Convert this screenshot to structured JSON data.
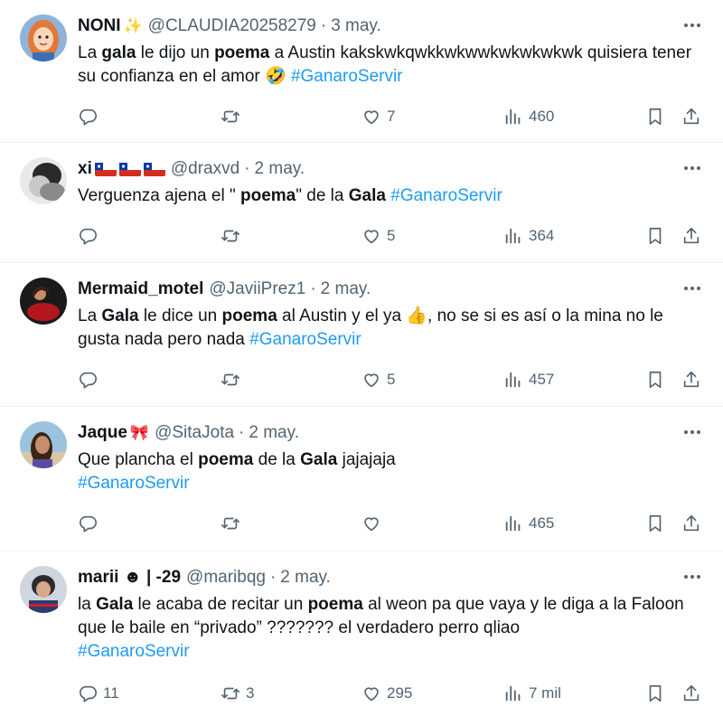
{
  "tweets": [
    {
      "name": "NONI",
      "name_emoji": "✨",
      "handle": "@CLAUDIA20258279",
      "date": "3 may.",
      "body": [
        {
          "t": "La "
        },
        {
          "t": "gala",
          "b": true
        },
        {
          "t": " le dijo un "
        },
        {
          "t": "poema",
          "b": true
        },
        {
          "t": " a Austin kakskwkqwkkwkwwkwkwkwkwk quisiera tener su confianza en el amor 🤣 "
        },
        {
          "t": "#GanaroServir",
          "h": true
        }
      ],
      "replies": "",
      "retweets": "",
      "likes": "7",
      "views": "460"
    },
    {
      "name": "xi",
      "flags": 3,
      "handle": "@draxvd",
      "date": "2 may.",
      "body": [
        {
          "t": "Verguenza ajena el \" "
        },
        {
          "t": "poema",
          "b": true
        },
        {
          "t": "\" de la "
        },
        {
          "t": "Gala",
          "b": true
        },
        {
          "t": " "
        },
        {
          "t": "#GanaroServir",
          "h": true
        }
      ],
      "replies": "",
      "retweets": "",
      "likes": "5",
      "views": "364"
    },
    {
      "name": "Mermaid_motel",
      "handle": "@JaviiPrez1",
      "date": "2 may.",
      "body": [
        {
          "t": "La "
        },
        {
          "t": "Gala",
          "b": true
        },
        {
          "t": " le dice un "
        },
        {
          "t": "poema",
          "b": true
        },
        {
          "t": " al Austin y el ya 👍, no se si es así o la mina no le gusta nada pero nada "
        },
        {
          "t": "#GanaroServir",
          "h": true
        }
      ],
      "replies": "",
      "retweets": "",
      "likes": "5",
      "views": "457"
    },
    {
      "name": "Jaque",
      "name_emoji": "🎀",
      "handle": "@SitaJota",
      "date": "2 may.",
      "body": [
        {
          "t": "Que plancha el "
        },
        {
          "t": "poema",
          "b": true
        },
        {
          "t": " de la "
        },
        {
          "t": "Gala",
          "b": true
        },
        {
          "t": " jajajaja"
        },
        {
          "br": true
        },
        {
          "t": "#GanaroServir",
          "h": true
        }
      ],
      "replies": "",
      "retweets": "",
      "likes": "",
      "views": "465"
    },
    {
      "name": "marii ☻ | -29",
      "handle": "@maribqg",
      "date": "2 may.",
      "body": [
        {
          "t": "la "
        },
        {
          "t": "Gala",
          "b": true
        },
        {
          "t": " le acaba de recitar un "
        },
        {
          "t": "poema",
          "b": true
        },
        {
          "t": " al weon pa que vaya y le diga a la Faloon que le baile en “privado” ??????? el verdadero perro qliao"
        },
        {
          "br": true
        },
        {
          "t": "#GanaroServir",
          "h": true
        }
      ],
      "replies": "11",
      "retweets": "3",
      "likes": "295",
      "views": "7 mil"
    }
  ],
  "colors": {
    "text": "#0f1419",
    "secondary": "#536471",
    "link": "#1d9bf0",
    "divider": "#eff3f4"
  },
  "icons": [
    "reply-icon",
    "retweet-icon",
    "like-icon",
    "views-icon",
    "bookmark-icon",
    "share-icon",
    "more-icon"
  ]
}
